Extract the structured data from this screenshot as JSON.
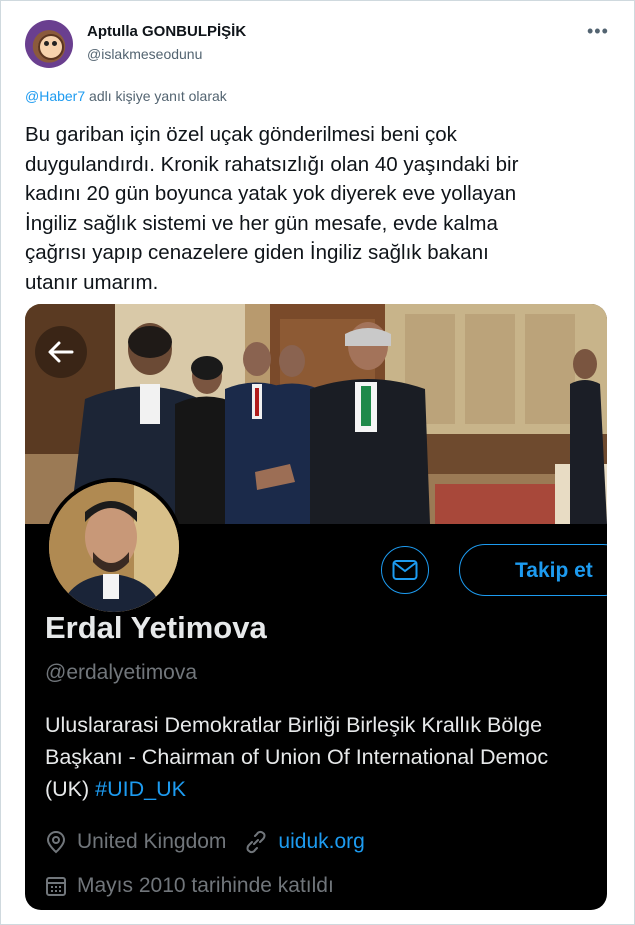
{
  "tweet": {
    "author_name": "Aptulla GONBULPİŞİK",
    "author_handle": "@islakmeseodunu",
    "more_icon": "more-icon",
    "reply_to_mention": "@Haber7",
    "reply_to_suffix": " adlı kişiye yanıt olarak",
    "text_lines": [
      "Bu gariban için özel uçak gönderilmesi beni çok",
      "duygulandırdı. Kronik rahatsızlığı olan 40 yaşındaki bir",
      "kadını 20 gün boyunca yatak yok diyerek eve yollayan",
      "İngiliz sağlık sistemi ve her gün mesafe, evde kalma",
      "çağrısı yapıp cenazelere giden İngiliz sağlık bakanı",
      "utanır umarım."
    ]
  },
  "profile_card": {
    "name": "Erdal Yetimova",
    "handle": "@erdalyetimova",
    "follow_label": "Takip et",
    "bio_line1": "Uluslararasi Demokratlar Birliği Birleşik Krallık Bölge",
    "bio_line2": "Başkanı - Chairman of Union Of International Democ",
    "bio_line3_prefix": "(UK) ",
    "bio_hashtag": "#UID_UK",
    "location": "United Kingdom",
    "website": "uiduk.org",
    "joined": "Mayıs 2010 tarihinde katıldı"
  },
  "colors": {
    "accent": "#1d9bf0",
    "card_bg": "#000000",
    "muted": "#71767b"
  }
}
